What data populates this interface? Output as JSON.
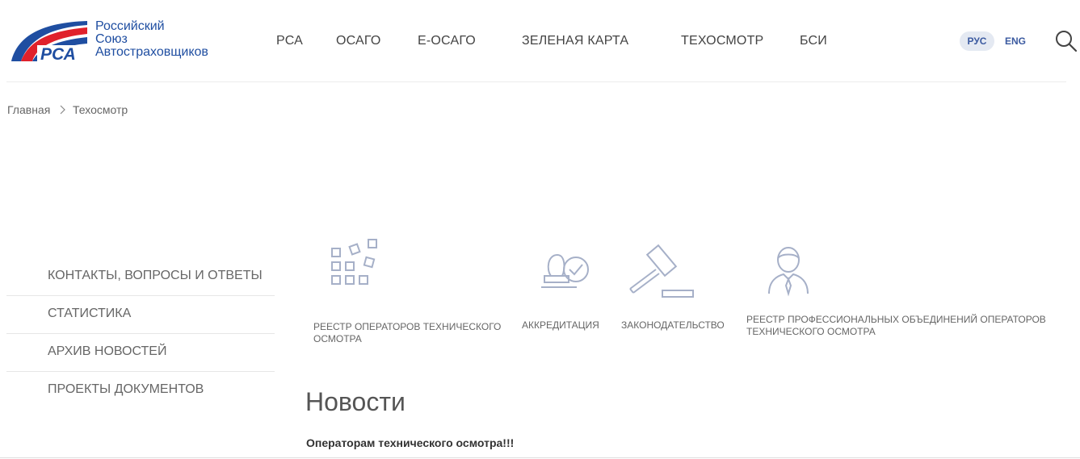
{
  "logo": {
    "abbr": "РСА",
    "lines": [
      "Российский",
      "Союз",
      "Автостраховщиков"
    ]
  },
  "nav": [
    "РСА",
    "ОСАГО",
    "Е-ОСАГО",
    "ЗЕЛЕНАЯ КАРТА",
    "ТЕХОСМОТР",
    "БСИ"
  ],
  "lang": {
    "active": "РУС",
    "other": "ENG"
  },
  "breadcrumb": {
    "home": "Главная",
    "current": "Техосмотр"
  },
  "side_menu": [
    "КОНТАКТЫ, ВОПРОСЫ И ОТВЕТЫ",
    "СТАТИСТИКА",
    "АРХИВ НОВОСТЕЙ",
    "ПРОЕКТЫ ДОКУМЕНТОВ"
  ],
  "services": [
    {
      "label": "РЕЕСТР ОПЕРАТОРОВ ТЕХНИЧЕСКОГО ОСМОТРА",
      "icon": "registry-grid-icon"
    },
    {
      "label": "АККРЕДИТАЦИЯ",
      "icon": "stamp-check-icon"
    },
    {
      "label": "ЗАКОНОДАТЕЛЬСТВО",
      "icon": "gavel-icon"
    },
    {
      "label": "РЕЕСТР ПРОФЕССИОНАЛЬНЫХ ОБЪЕДИНЕНИЙ ОПЕРАТОРОВ ТЕХНИЧЕСКОГО ОСМОТРА",
      "icon": "person-icon"
    }
  ],
  "news": {
    "title": "Новости",
    "items": [
      "Операторам технического осмотра!!!"
    ]
  },
  "colors": {
    "brand_blue": "#1f4ea1",
    "brand_red": "#e0212b",
    "icon_gray": "#a6b0c8"
  }
}
